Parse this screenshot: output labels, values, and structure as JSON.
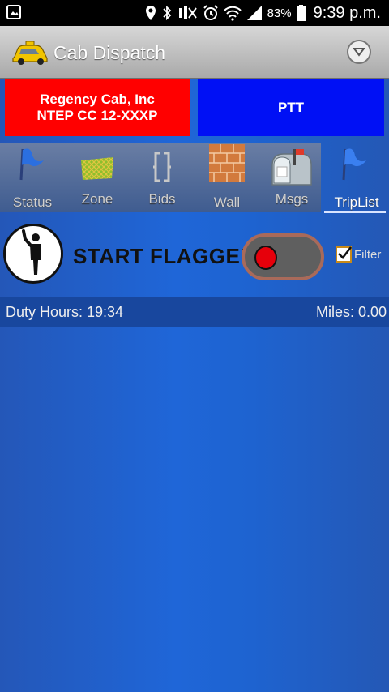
{
  "status_bar": {
    "battery_percent": "83%",
    "time": "9:39 p.m.",
    "icons": [
      "image-icon",
      "location-icon",
      "bluetooth-icon",
      "mute-icon",
      "alarm-icon",
      "wifi-icon",
      "signal-icon",
      "battery-icon"
    ]
  },
  "app_bar": {
    "title": "Cab Dispatch",
    "logo_icon": "taxi-icon",
    "menu_icon": "chevron-down-circle-icon"
  },
  "company": {
    "name": "Regency Cab, Inc",
    "id": "NTEP CC 12-XXXP",
    "color": "#ff0000"
  },
  "ptt": {
    "label": "PTT",
    "color": "#0010f5"
  },
  "tabs": [
    {
      "label": "Status",
      "icon": "blue-flag-icon"
    },
    {
      "label": "Zone",
      "icon": "zone-map-icon"
    },
    {
      "label": "Bids",
      "icon": "bids-bracket-icon"
    },
    {
      "label": "Wall",
      "icon": "brick-wall-icon"
    },
    {
      "label": "Msgs",
      "icon": "mailbox-icon"
    },
    {
      "label": "TripList",
      "icon": "blue-flag-icon",
      "active": true
    }
  ],
  "flagged": {
    "label": "START FLAGGED",
    "toggle_on": false,
    "filter_label": "Filter",
    "filter_checked": true
  },
  "info": {
    "duty_hours": "Duty Hours: 19:34",
    "miles": "Miles: 0.00"
  }
}
